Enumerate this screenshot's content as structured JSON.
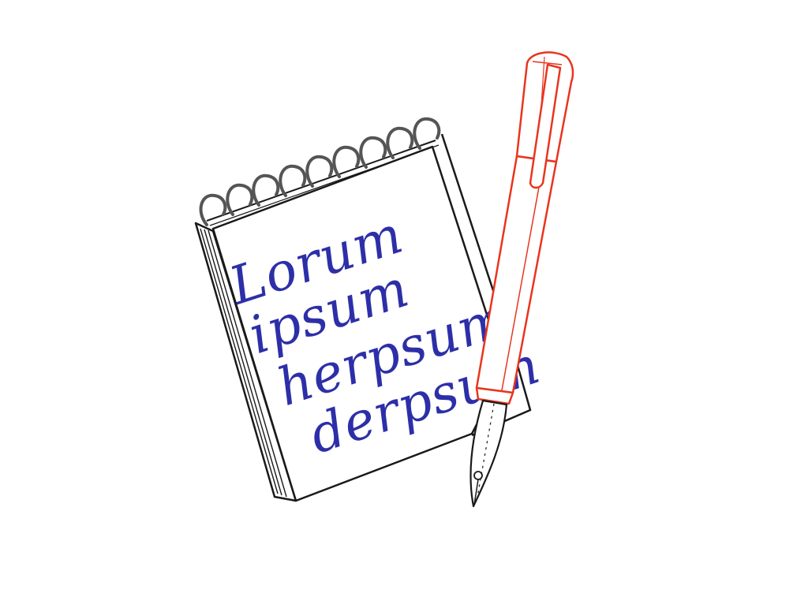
{
  "illustration": {
    "notepad": {
      "lines": [
        "Lorum",
        "ipsum",
        "herpsum",
        "derpsum"
      ]
    },
    "colors": {
      "ink_blue": "#2d2fa8",
      "pen_red": "#e8351f",
      "outline": "#1a1a1a",
      "spiral": "#555555",
      "background": "#ffffff"
    }
  }
}
